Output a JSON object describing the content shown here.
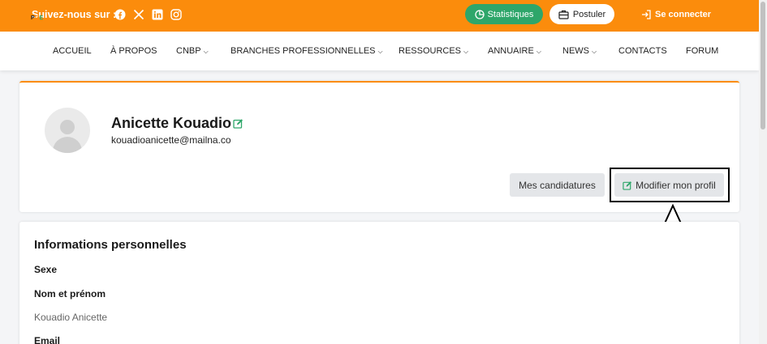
{
  "topbar": {
    "follow_label": "Suivez-nous sur :",
    "social_icons": [
      "facebook-icon",
      "x-icon",
      "linkedin-icon",
      "instagram-icon"
    ],
    "stats_label": "Statistiques",
    "postuler_label": "Postuler",
    "login_label": "Se connecter",
    "colors": {
      "brand": "#fb8c0c",
      "green": "#2ea66a"
    }
  },
  "nav": {
    "logo": {
      "p": "P",
      "o": "O",
      "e": "E"
    },
    "items": [
      {
        "label": "ACCUEIL",
        "dropdown": false
      },
      {
        "label": "À PROPOS",
        "dropdown": false
      },
      {
        "label": "CNBP",
        "dropdown": true
      },
      {
        "label": "BRANCHES PROFESSIONNELLES",
        "dropdown": true
      },
      {
        "label": "RESSOURCES",
        "dropdown": true
      },
      {
        "label": "ANNUAIRE",
        "dropdown": true
      },
      {
        "label": "NEWS",
        "dropdown": true
      },
      {
        "label": "CONTACTS",
        "dropdown": false
      },
      {
        "label": "FORUM",
        "dropdown": false
      }
    ]
  },
  "profile": {
    "name": "Anicette Kouadio",
    "email": "kouadioanicette@mailna.co",
    "candidatures_label": "Mes candidatures",
    "edit_label": "Modifier mon profil"
  },
  "info": {
    "title": "Informations personnelles",
    "fields": [
      {
        "label": "Sexe",
        "value": ""
      },
      {
        "label": "Nom et prénom",
        "value": "Kouadio Anicette"
      },
      {
        "label": "Email",
        "value": ""
      }
    ]
  }
}
